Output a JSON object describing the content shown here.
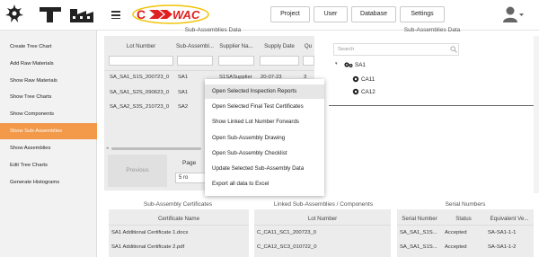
{
  "nav": {
    "project": "Project",
    "user": "User",
    "database": "Database",
    "settings": "Settings"
  },
  "brand": {
    "text": "WAC",
    "accent": "#e02020",
    "ring": "#f2c200"
  },
  "sidebar": {
    "items": [
      {
        "label": "Create Tree Chart"
      },
      {
        "label": "Add Raw Materials"
      },
      {
        "label": "Show Raw Materials"
      },
      {
        "label": "Show Tree Charts"
      },
      {
        "label": "Show Components"
      },
      {
        "label": "Show Sub-Assemblies"
      },
      {
        "label": "Show Assemblies"
      },
      {
        "label": "Edit Tree Charts"
      },
      {
        "label": "Generate Histograms"
      }
    ],
    "active_color": "#f2994a"
  },
  "left_panel": {
    "title": "Sub-Assemblies Data",
    "columns": [
      "Lot Number",
      "Sub-Assembl...",
      "Supplier Na...",
      "Supply Date",
      "Qu"
    ],
    "rows": [
      [
        "SA_SA1_S1S_200723_0",
        "SA1",
        "S1SASupplier",
        "20-07-23",
        "3"
      ],
      [
        "SA_SA1_S2S_090623_0",
        "SA1",
        "",
        "",
        ""
      ],
      [
        "SA_SA2_S3S_210723_0",
        "SA2",
        "",
        "",
        ""
      ]
    ],
    "previous": "Previous",
    "page_label": "Page",
    "page_size": "5 ro"
  },
  "context_menu": {
    "items": [
      "Open Selected Inspection Reports",
      "Open Selected Final Test Certificates",
      "Show Linked Lot Number Forwards",
      "Open Sub-Assembly Drawing",
      "Open Sub-Assembly Checklist",
      "Update Selected Sub-Assembly Data",
      "Export all data to Excel"
    ]
  },
  "right_panel": {
    "title": "Sub-Assemblies Data",
    "search_placeholder": "Search",
    "tree": {
      "root": "SA1",
      "children": [
        "CA11",
        "CA12"
      ]
    }
  },
  "certs": {
    "title": "Sub-Assembly Certificates",
    "column": "Certificate Name",
    "rows": [
      "SA1 Additional Certificate 1.docx",
      "SA1 Additional Certificate 2.pdf"
    ]
  },
  "linked": {
    "title": "Linked Sub-Assemblies / Components",
    "column": "Lot Number",
    "rows": [
      "C_CA11_SC1_200723_0",
      "C_CA12_SC3_010722_0"
    ]
  },
  "serials": {
    "title": "Serial Numbers",
    "columns": [
      "Serial Number",
      "Status",
      "Equivalent Ve..."
    ],
    "rows": [
      [
        "SA_SA1_S1S...",
        "Accepted",
        "SA-SA1-1-1"
      ],
      [
        "SA_SA1_S1S...",
        "Accepted",
        "SA-SA1-1-2"
      ]
    ]
  }
}
